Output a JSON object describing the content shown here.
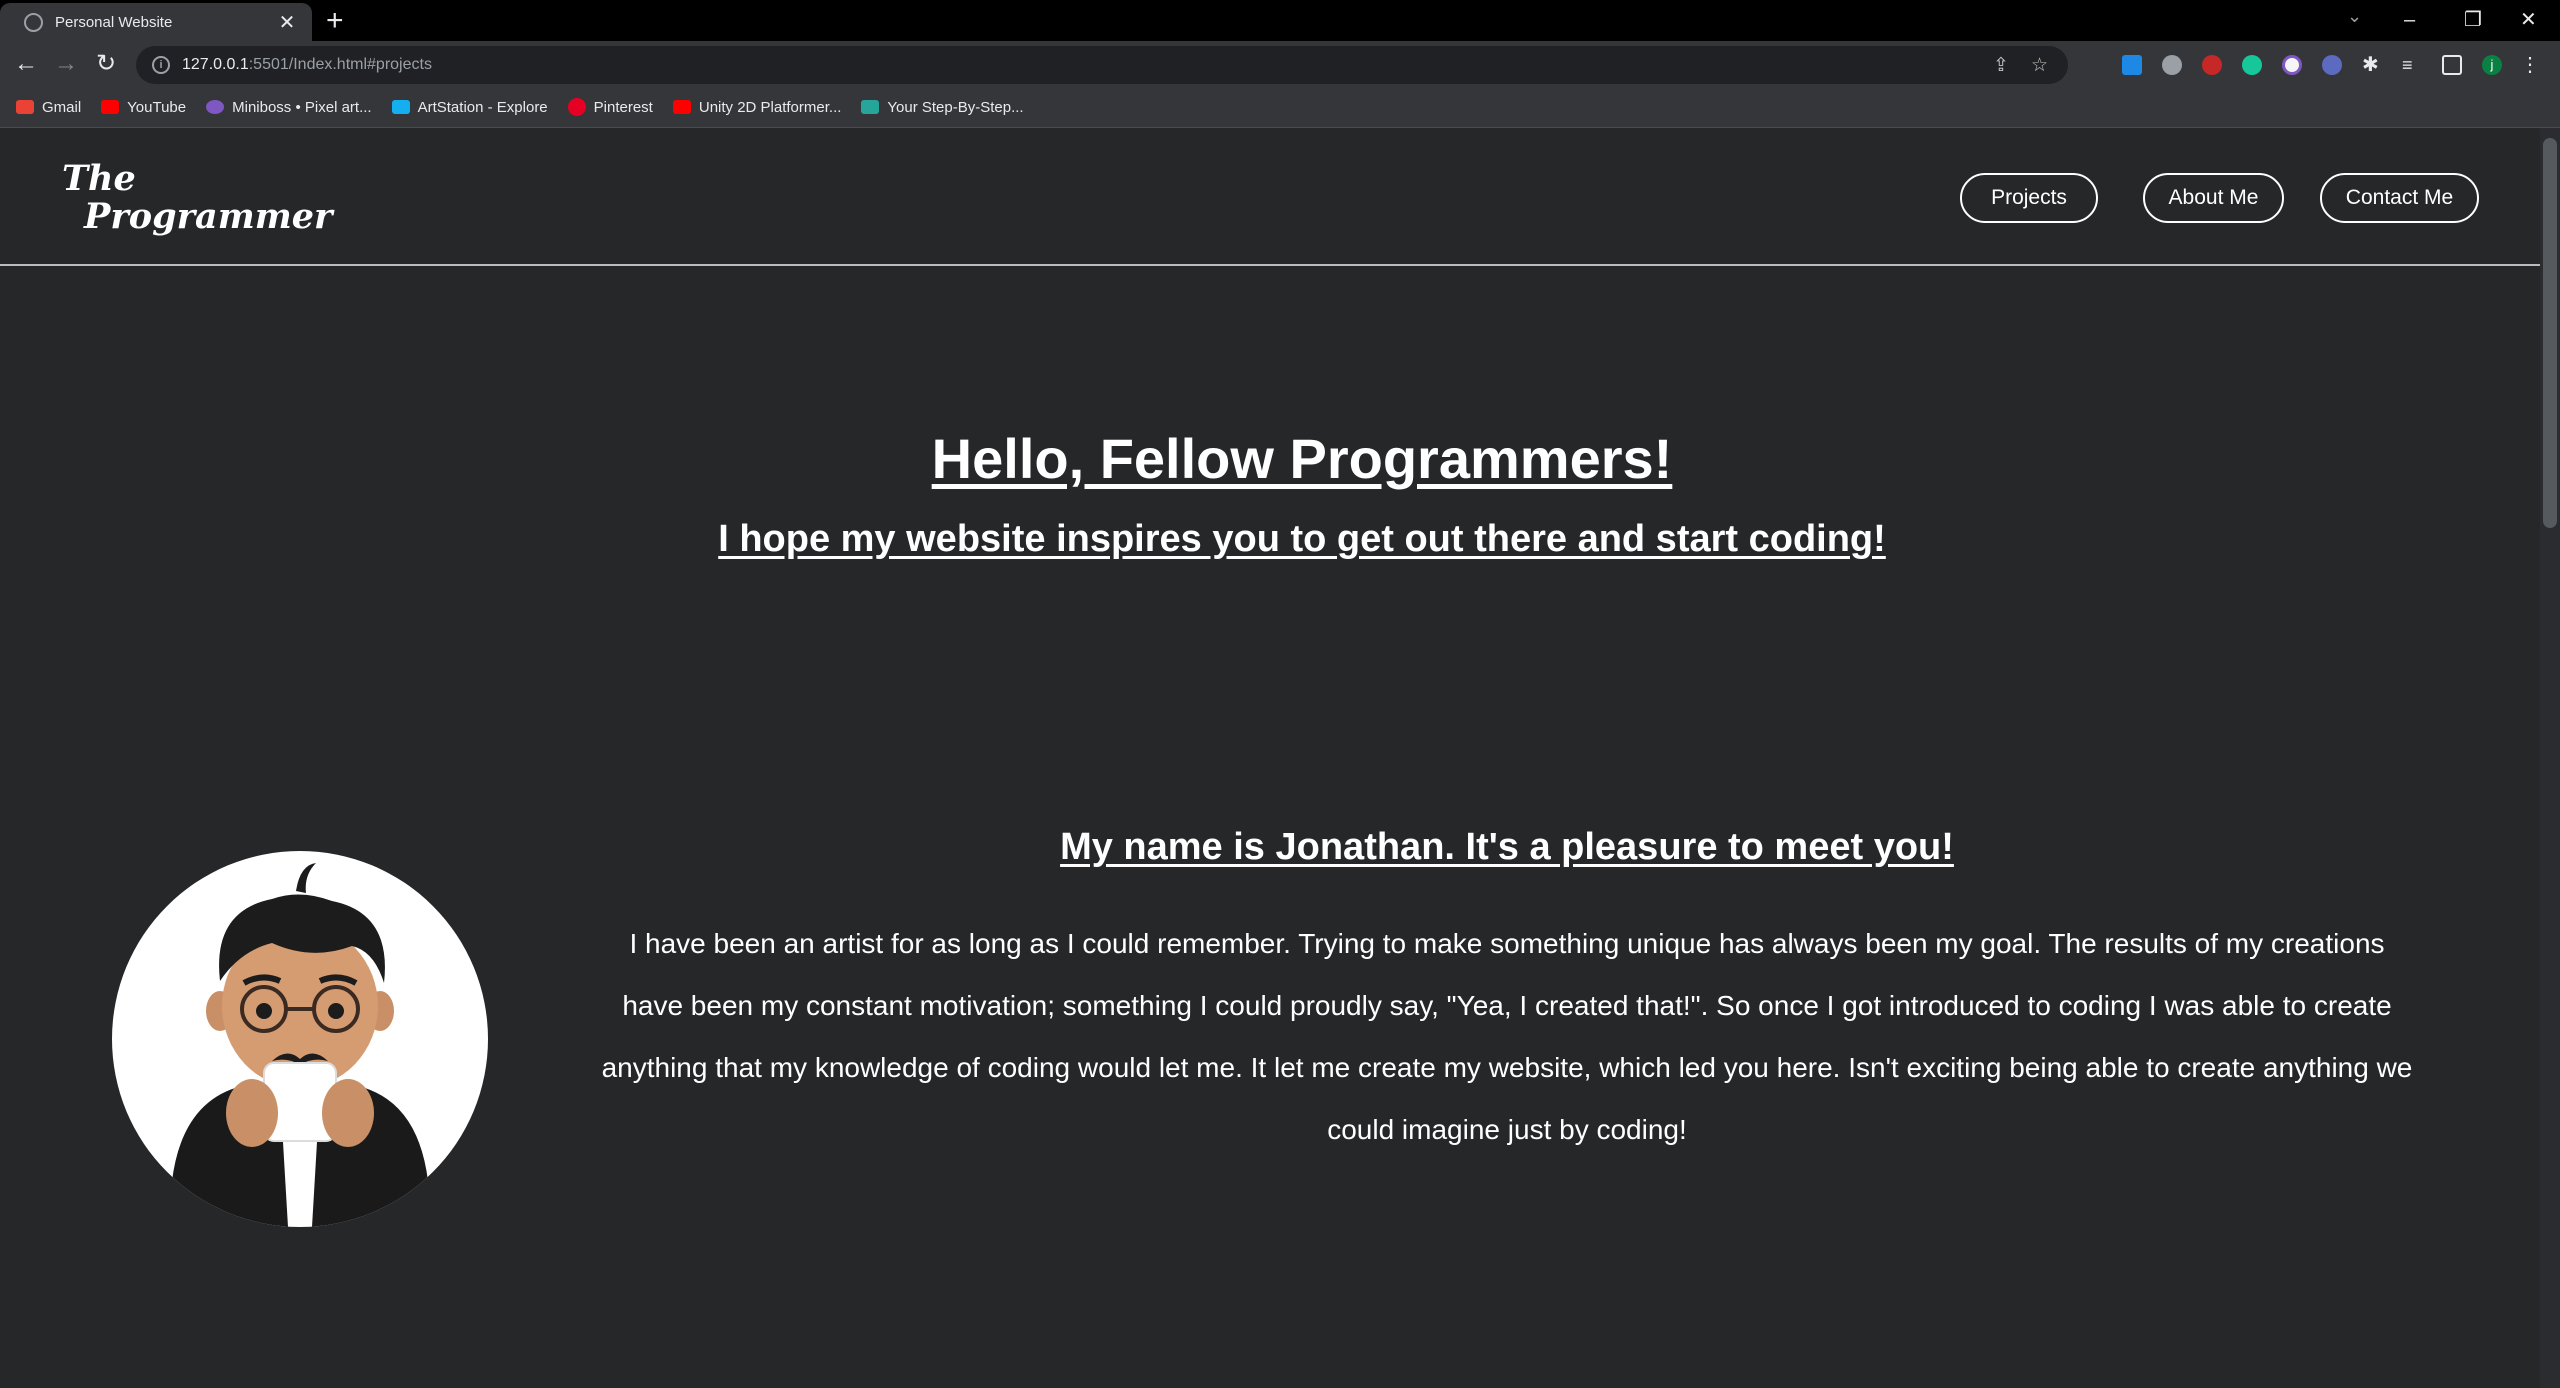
{
  "browser": {
    "tab_title": "Personal Website",
    "tab_close": "✕",
    "new_tab": "+",
    "url_host": "127.0.0.1",
    "url_rest": ":5501/Index.html#projects",
    "bookmarks": [
      "Gmail",
      "YouTube",
      "Miniboss • Pixel art...",
      "ArtStation - Explore",
      "Pinterest",
      "Unity 2D Platformer...",
      "Your Step-By-Step..."
    ],
    "profile_initial": "j"
  },
  "site": {
    "logo_line1": "The",
    "logo_line2": "Programmer",
    "nav": [
      "Projects",
      "About Me",
      "Contact Me"
    ],
    "hero_title": "Hello, Fellow Programmers!",
    "hero_subtitle": "I hope my website inspires you to get out there and start coding!",
    "intro_title": "My name is Jonathan. It's a pleasure to meet you!",
    "intro_body": "I have been an artist for as long as I could remember. Trying to make something unique has always been my goal. The results of my creations have been my constant motivation; something I could proudly say, \"Yea, I created that!\". So once I got introduced to coding I was able to create anything that my knowledge of coding would let me. It let me create my website, which led you here. Isn't exciting being able to create anything we could imagine just by coding!"
  },
  "colors": {
    "page_bg": "#262729",
    "chrome_bg": "#35363a",
    "text": "#ffffff"
  }
}
